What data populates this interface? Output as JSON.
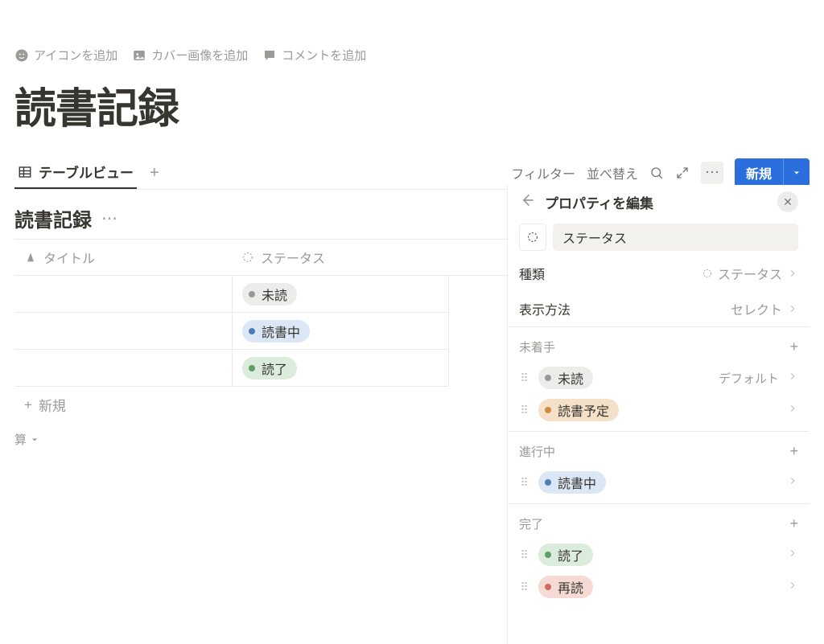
{
  "page_actions": {
    "add_icon": "アイコンを追加",
    "add_cover": "カバー画像を追加",
    "add_comment": "コメントを追加"
  },
  "page_title": "読書記録",
  "viewbar": {
    "view_name": "テーブルビュー",
    "filter": "フィルター",
    "sort": "並べ替え",
    "new_button": "新規"
  },
  "database": {
    "title": "読書記録",
    "columns": {
      "title": "タイトル",
      "status": "ステータス"
    },
    "rows": [
      {
        "status_label": "未読",
        "status_color": "gray"
      },
      {
        "status_label": "読書中",
        "status_color": "blue"
      },
      {
        "status_label": "読了",
        "status_color": "green"
      }
    ],
    "new_row": "新規",
    "calc": "算"
  },
  "panel": {
    "title": "プロパティを編集",
    "property_name": "ステータス",
    "type_label": "種類",
    "type_value": "ステータス",
    "display_label": "表示方法",
    "display_value": "セレクト",
    "groups": [
      {
        "name": "未着手",
        "options": [
          {
            "label": "未読",
            "color": "gray",
            "default": true
          },
          {
            "label": "読書予定",
            "color": "orange",
            "default": false
          }
        ]
      },
      {
        "name": "進行中",
        "options": [
          {
            "label": "読書中",
            "color": "blue",
            "default": false
          }
        ]
      },
      {
        "name": "完了",
        "options": [
          {
            "label": "読了",
            "color": "green",
            "default": false
          },
          {
            "label": "再読",
            "color": "red",
            "default": false
          }
        ]
      }
    ],
    "default_text": "デフォルト"
  }
}
